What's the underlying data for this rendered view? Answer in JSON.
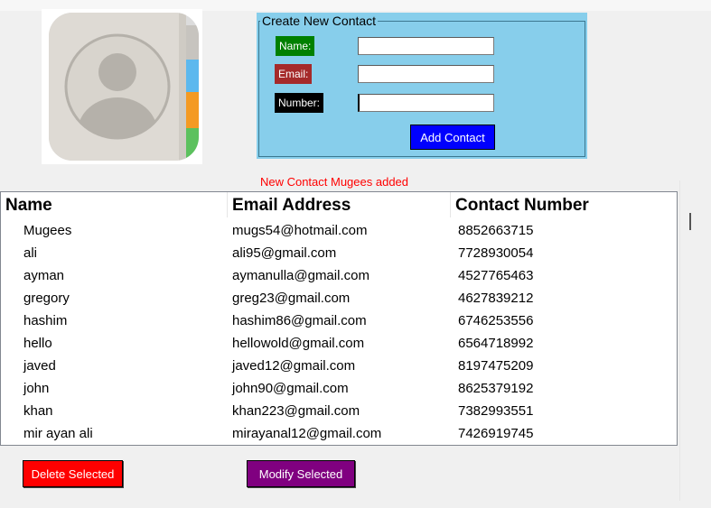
{
  "form": {
    "title": "Create New Contact",
    "name_label": "Name:",
    "email_label": "Email:",
    "number_label": "Number:",
    "name_value": "",
    "email_value": "",
    "number_value": "",
    "add_button": "Add Contact"
  },
  "status_message": "New Contact Mugees added",
  "table": {
    "columns": [
      "Name",
      "Email Address",
      "Contact Number"
    ],
    "rows": [
      [
        "Mugees",
        "mugs54@hotmail.com",
        "8852663715"
      ],
      [
        "ali",
        "ali95@gmail.com",
        "7728930054"
      ],
      [
        "ayman",
        "aymanulla@gmail.com",
        "4527765463"
      ],
      [
        "gregory",
        "greg23@gmail.com",
        "4627839212"
      ],
      [
        "hashim",
        "hashim86@gmail.com",
        "6746253556"
      ],
      [
        "hello",
        "hellowold@gmail.com",
        "6564718992"
      ],
      [
        "javed",
        "javed12@gmail.com",
        "8197475209"
      ],
      [
        "john",
        "john90@gmail.com",
        "8625379192"
      ],
      [
        "khan",
        "khan223@gmail.com",
        "7382993551"
      ],
      [
        "mir ayan ali",
        "mirayanal12@gmail.com",
        "7426919745"
      ]
    ]
  },
  "actions": {
    "delete_button": "Delete Selected",
    "modify_button": "Modify Selected"
  },
  "colors": {
    "frame_bg": "#87ceeb",
    "name_label_bg": "#008000",
    "email_label_bg": "#a52a2a",
    "number_label_bg": "#000000",
    "add_button_bg": "#0000ff",
    "status_text": "#ff0000",
    "delete_button_bg": "#ff0000",
    "modify_button_bg": "#800080"
  },
  "icons": {
    "logo": "contacts-book-icon"
  }
}
